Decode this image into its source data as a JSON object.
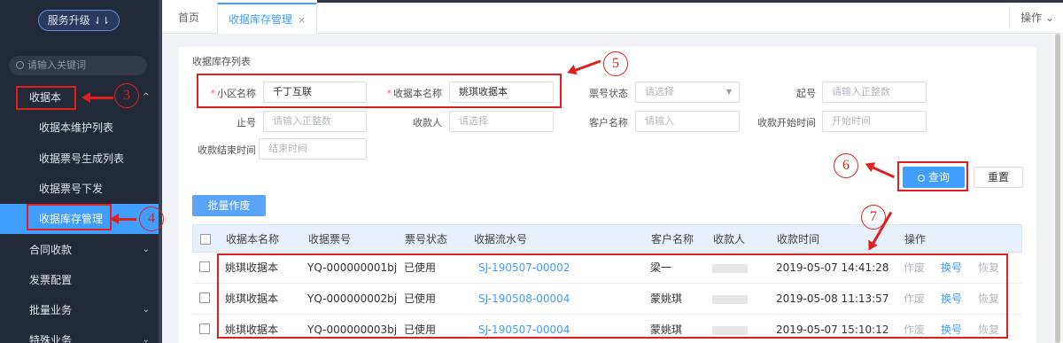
{
  "sidebar": {
    "upgrade_label": "服务升级",
    "upgrade_icon": "⇃⇂",
    "search_placeholder": "请输入关键词",
    "items": [
      {
        "label": "收据本",
        "chevron": "^"
      },
      {
        "label": "收据本维护列表"
      },
      {
        "label": "收据票号生成列表"
      },
      {
        "label": "收据票号下发"
      },
      {
        "label": "收据库存管理"
      },
      {
        "label": "合同收款",
        "chevron": "⌄"
      },
      {
        "label": "发票配置"
      },
      {
        "label": "批量业务",
        "chevron": "⌄"
      },
      {
        "label": "特殊业务",
        "chevron": "⌄"
      }
    ]
  },
  "annotations": [
    "3",
    "4",
    "5",
    "6",
    "7"
  ],
  "tabs": {
    "home": "首页",
    "current": "收据库存管理",
    "close": "×",
    "ops": "操作 ⌄"
  },
  "panel": {
    "title": "收据库存列表",
    "fields": {
      "community": {
        "label": "小区名称",
        "value": "千丁互联"
      },
      "receipt_book": {
        "label": "收据本名称",
        "value": "姚琪收据本"
      },
      "ticket_status": {
        "label": "票号状态",
        "placeholder": "请选择"
      },
      "start_no": {
        "label": "起号",
        "placeholder": "请输入正整数"
      },
      "end_no": {
        "label": "止号",
        "placeholder": "请输入正整数"
      },
      "payee": {
        "label": "收款人",
        "placeholder": "请选择"
      },
      "customer": {
        "label": "客户名称",
        "placeholder": "请输入"
      },
      "start_time": {
        "label": "收款开始时间",
        "placeholder": "开始时间"
      },
      "end_time": {
        "label": "收款结束时间",
        "placeholder": "结束时间"
      }
    },
    "query_label": "查询",
    "reset_label": "重置",
    "batch_label": "批量作废"
  },
  "table": {
    "headers": [
      "收据本名称",
      "收据票号",
      "票号状态",
      "收据流水号",
      "客户名称",
      "收款人",
      "收款时间",
      "操作"
    ],
    "rows": [
      {
        "book": "姚琪收据本",
        "ticket": "YQ-000000001bj",
        "status": "已使用",
        "serial": "SJ-190507-00002",
        "customer": "梁一",
        "payee": "",
        "time": "2019-05-07 14:41:28",
        "ops": [
          "作废",
          "换号",
          "恢复"
        ]
      },
      {
        "book": "姚琪收据本",
        "ticket": "YQ-000000002bj",
        "status": "已使用",
        "serial": "SJ-190508-00004",
        "customer": "蒙姚琪",
        "payee": "",
        "time": "2019-05-08 11:13:57",
        "ops": [
          "作废",
          "换号",
          "恢复"
        ]
      },
      {
        "book": "姚琪收据本",
        "ticket": "YQ-000000003bj",
        "status": "已使用",
        "serial": "SJ-190507-00004",
        "customer": "蒙姚琪",
        "payee": "",
        "time": "2019-05-07 15:10:12",
        "ops": [
          "作废",
          "换号",
          "恢复"
        ]
      }
    ]
  },
  "colors": {
    "accent": "#409eff",
    "sidebar_bg": "#232a37",
    "annotation": "#e02020"
  }
}
